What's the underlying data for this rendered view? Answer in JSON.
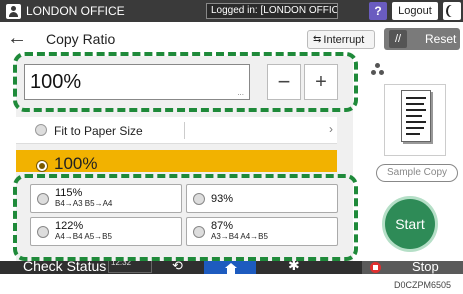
{
  "topbar": {
    "user_name": "LONDON OFFICE",
    "logged_in_text": "Logged in: [LONDON OFFICE]",
    "help_label": "?",
    "logout_label": "Logout"
  },
  "header": {
    "back_label": "←",
    "title": "Copy Ratio",
    "interrupt_label": "Interrupt",
    "reset_label": "Reset"
  },
  "ratio_entry": {
    "value": "100%",
    "minus_label": "−",
    "plus_label": "+"
  },
  "fit_option": {
    "label": "Fit to Paper Size",
    "chevron": "›"
  },
  "selected_ratio": "100%",
  "presets": [
    {
      "percent": "115%",
      "detail": "B4→A3  B5→A4"
    },
    {
      "percent": "93%",
      "detail": ""
    },
    {
      "percent": "122%",
      "detail": "A4→B4  A5→B5"
    },
    {
      "percent": "87%",
      "detail": "A3→B4  A4→B5"
    }
  ],
  "right_panel": {
    "sample_copy_label": "Sample Copy",
    "start_label": "Start"
  },
  "bottombar": {
    "check_status_label": "Check Status",
    "datetime": "12:32",
    "stop_label": "Stop"
  },
  "watermark": "D0CZPM6505",
  "colors": {
    "highlight_dashes": "#1f8a3a",
    "selected_row": "#f2b200",
    "start_button": "#2e8b57",
    "home_button": "#1d5bbf",
    "help_button": "#6a5cc0"
  }
}
